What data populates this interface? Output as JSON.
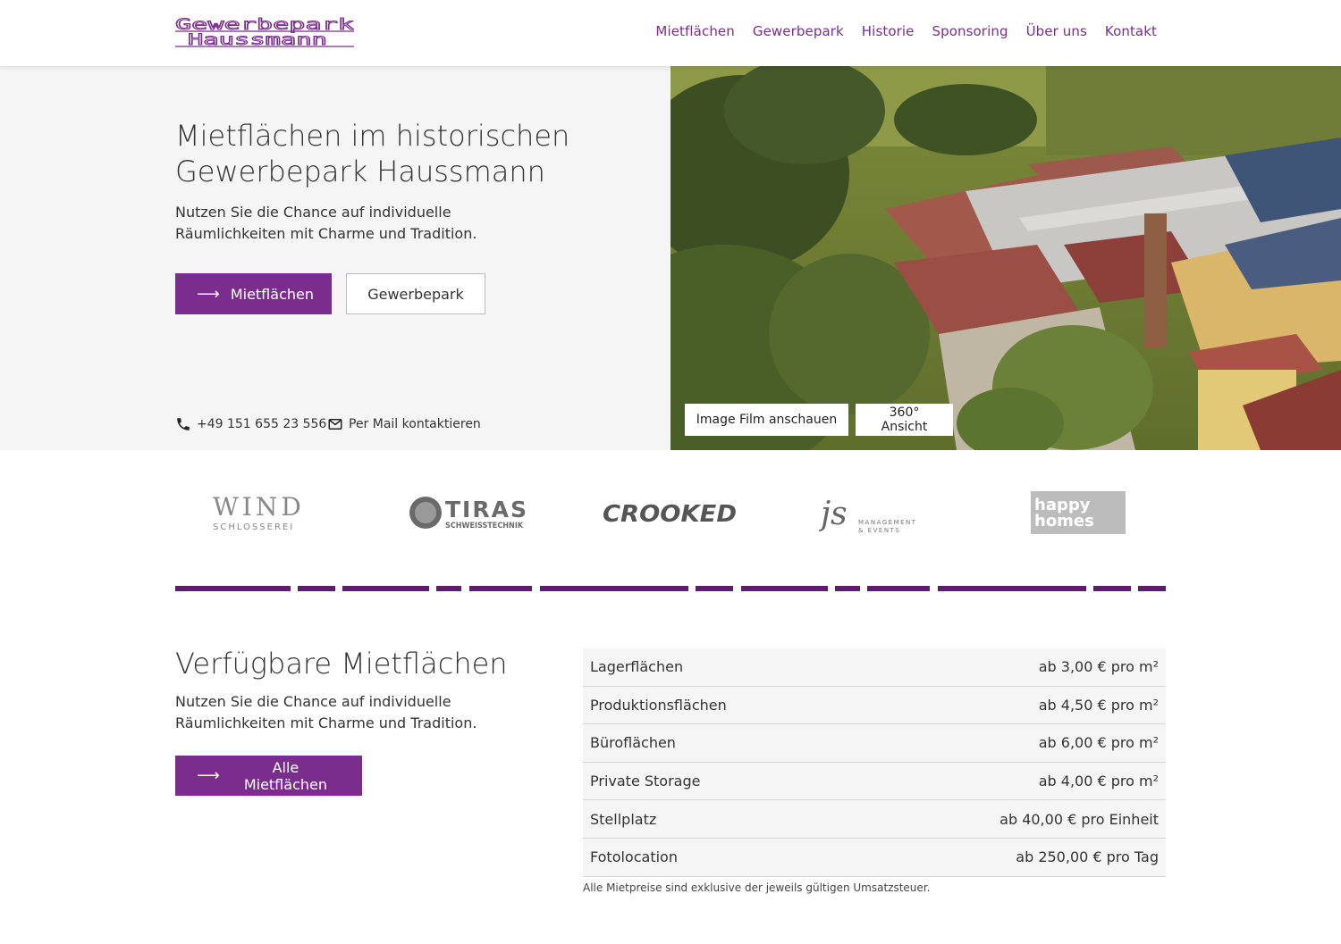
{
  "brand": {
    "line1": "Gewerbepark",
    "line2": "Haussmann",
    "accent": "#7a2d8c"
  },
  "nav": [
    "Mietflächen",
    "Gewerbepark",
    "Historie",
    "Sponsoring",
    "Über uns",
    "Kontakt"
  ],
  "hero": {
    "title": "Mietflächen im historischen Gewerbepark Haussmann",
    "subtitle": "Nutzen Sie die Chance auf individuelle Räumlichkeiten mit Charme und Tradition.",
    "primary_button": "Mietflächen",
    "secondary_button": "Gewerbepark",
    "phone": "+49 151 655 23 556",
    "mail": "Per Mail kontaktieren",
    "video_button": "Image Film anschauen",
    "view360_button": "360° Ansicht"
  },
  "partners": {
    "wind": {
      "name": "WIND",
      "sub": "SCHLOSSEREI"
    },
    "tiras": {
      "name": "TIRAS",
      "sub": "SCHWEISSTECHNIK"
    },
    "crooked": {
      "name": "CROOKED"
    },
    "js": {
      "name": "js",
      "sub1": "MANAGEMENT",
      "sub2": "& EVENTS"
    },
    "happy": {
      "line1": "happy",
      "line2": "homes"
    }
  },
  "rentals": {
    "title": "Verfügbare Mietflächen",
    "subtitle": "Nutzen Sie die Chance auf individuelle Räumlichkeiten mit Charme und Tradition.",
    "button": "Alle Mietflächen",
    "rows": [
      {
        "label": "Lagerflächen",
        "price": "ab 3,00 € pro m²"
      },
      {
        "label": "Produktionsflächen",
        "price": "ab 4,50 € pro m²"
      },
      {
        "label": "Büroflächen",
        "price": "ab 6,00 € pro m²"
      },
      {
        "label": "Private Storage",
        "price": "ab 4,00 € pro m²"
      },
      {
        "label": "Stellplatz",
        "price": "ab 40,00 € pro Einheit"
      },
      {
        "label": "Fotolocation",
        "price": "ab 250,00 € pro Tag"
      }
    ],
    "note": "Alle Mietpreise sind exklusive der jeweils gültigen Umsatzsteuer."
  }
}
